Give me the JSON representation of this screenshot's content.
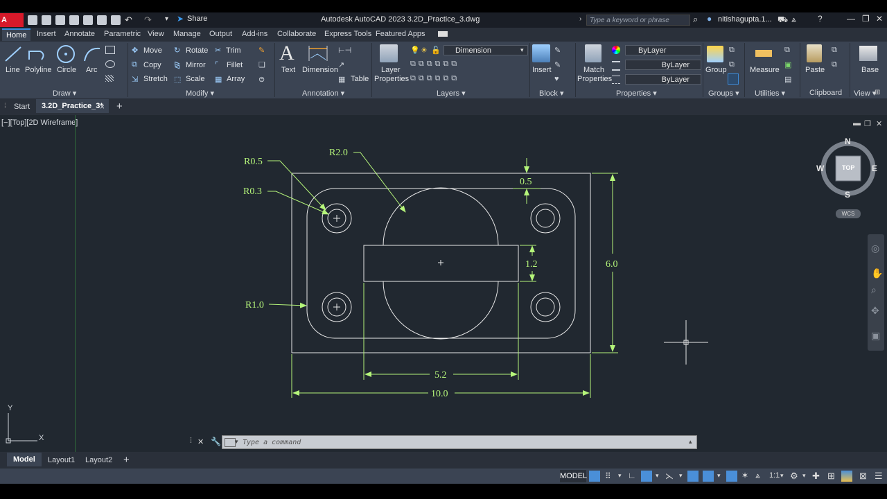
{
  "app": {
    "logo_text": "A CAD",
    "title": "Autodesk AutoCAD 2023    3.2D_Practice_3.dwg",
    "share_label": "Share",
    "search_placeholder": "Type a keyword or phrase",
    "user_name": "nitishagupta.1..."
  },
  "ribbon_tabs": [
    "Home",
    "Insert",
    "Annotate",
    "Parametric",
    "View",
    "Manage",
    "Output",
    "Add-ins",
    "Collaborate",
    "Express Tools",
    "Featured Apps"
  ],
  "ribbon": {
    "draw": {
      "line": "Line",
      "polyline": "Polyline",
      "circle": "Circle",
      "arc": "Arc",
      "label": "Draw ▾"
    },
    "modify": {
      "move": "Move",
      "rotate": "Rotate",
      "trim": "Trim",
      "copy": "Copy",
      "mirror": "Mirror",
      "fillet": "Fillet",
      "stretch": "Stretch",
      "scale": "Scale",
      "array": "Array",
      "label": "Modify ▾"
    },
    "annotation": {
      "text": "Text",
      "dimension": "Dimension",
      "table": "Table",
      "label": "Annotation ▾"
    },
    "layers": {
      "layer_properties_1": "Layer",
      "layer_properties_2": "Properties",
      "current_layer": "Dimension",
      "label": "Layers ▾"
    },
    "block": {
      "insert": "Insert",
      "label": "Block ▾"
    },
    "properties": {
      "match_1": "Match",
      "match_2": "Properties",
      "color": "ByLayer",
      "linetype": "ByLayer",
      "lineweight": "ByLayer",
      "label": "Properties ▾"
    },
    "groups": {
      "group": "Group",
      "label": "Groups ▾"
    },
    "utilities": {
      "measure": "Measure",
      "label": "Utilities ▾"
    },
    "clipboard": {
      "paste": "Paste",
      "label": "Clipboard"
    },
    "view": {
      "base": "Base",
      "label": "View ▾"
    }
  },
  "file_tabs": {
    "start": "Start",
    "active": "3.2D_Practice_3*",
    "close": "×",
    "add": "+"
  },
  "viewport": {
    "label": "[−][Top][2D Wireframe]",
    "viewcube": {
      "n": "N",
      "s": "S",
      "e": "E",
      "w": "W",
      "top": "TOP",
      "wcs": "WCS"
    },
    "ucs": {
      "x": "X",
      "y": "Y"
    }
  },
  "drawing": {
    "dims": {
      "r05": "R0.5",
      "r03": "R0.3",
      "r20": "R2.0",
      "r10": "R1.0",
      "d05": "0.5",
      "d12": "1.2",
      "d60": "6.0",
      "d52": "5.2",
      "d100": "10.0"
    }
  },
  "command": {
    "placeholder": "Type a command"
  },
  "layout_tabs": {
    "model": "Model",
    "layout1": "Layout1",
    "layout2": "Layout2",
    "add": "+"
  },
  "status": {
    "model": "MODEL",
    "scale": "1:1"
  }
}
